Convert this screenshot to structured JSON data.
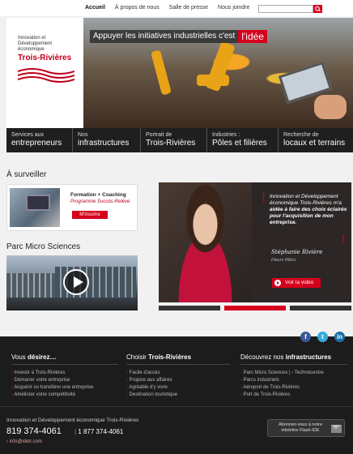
{
  "topnav": {
    "links": [
      "Accueil",
      "À propos de nous",
      "Salle de presse",
      "Nous joindre"
    ],
    "search_placeholder": ""
  },
  "logo": {
    "line1": "Innovation et",
    "line2": "Développement",
    "line3": "économique",
    "name": "Trois-Rivières"
  },
  "hero": {
    "caption": "Appuyer les initiatives industrielles c'est",
    "highlight": "l'idée"
  },
  "main_menu": [
    {
      "small": "Services aux",
      "big": "entrepreneurs"
    },
    {
      "small": "Nos",
      "big": "infrastructures"
    },
    {
      "small": "Portrait de",
      "big": "Trois-Rivières"
    },
    {
      "small": "Industries :",
      "big": "Pôles et filières"
    },
    {
      "small": "Recherche de",
      "big": "locaux et terrains"
    }
  ],
  "surveiller": {
    "title": "À surveiller",
    "promo_title": "Formation + Coaching",
    "promo_subtitle": "Programme Succès-Relève",
    "promo_button": "M'inscrire"
  },
  "micro": {
    "title": "Parc Micro Sciences"
  },
  "testimonial": {
    "quote_a": "Innovation et Développement économique Trois-Rivières m'a",
    "quote_b": "aidée à faire des choix éclairés pour l'acquisition de mon entreprise.",
    "signature": "Stéphanie Rivière",
    "role": "Fleurs Rilico",
    "video_button": "Voir la vidéo"
  },
  "social": {
    "facebook": "f",
    "twitter": "t",
    "linkedin": "in"
  },
  "footer": {
    "col1_head_a": "Vous",
    "col1_head_b": "désirez…",
    "col1_items": [
      "Investir à Trois-Rivières",
      "Démarrer votre entreprise",
      "Acquérir ou transférer une entreprise",
      "Améliorer votre compétitivité"
    ],
    "col2_head_a": "Choisir",
    "col2_head_b": "Trois-Rivières",
    "col2_items": [
      "Facile d'accès",
      "Propice aux affaires",
      "Agréable d'y vivre",
      "Destination touristique"
    ],
    "col3_head_a": "Découvrez nos",
    "col3_head_b": "infrastructures",
    "col3_items": [
      "Parc Micro Sciences  |  › Technocentre",
      "Parcs industriels",
      "Aéroport de Trois-Rivières",
      "Port de Trois-Rivières"
    ],
    "org_name": "Innovation et Développement économique Trois-Rivières",
    "phone": "819 374-4061",
    "phone_toll": "1 877 374-4061",
    "email": "› info@idetr.com",
    "newsletter": "Abonnez-vous à notre infolettre Flash-IDE"
  }
}
